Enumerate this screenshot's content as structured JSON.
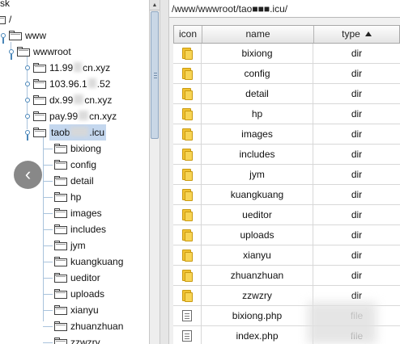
{
  "tree": {
    "top_cut_label": "sk",
    "root_label": "/",
    "www_label": "www",
    "wwwroot_label": "wwwroot",
    "sites": [
      {
        "label_a": "11.99",
        "label_b": "cn.xyz"
      },
      {
        "label_a": "103.96.1",
        "label_b": ".52"
      },
      {
        "label_a": "dx.99",
        "label_b": "cn.xyz"
      },
      {
        "label_a": "pay.99",
        "label_b": "cn.xyz"
      },
      {
        "label_a": "taob",
        "label_b": ".icu"
      }
    ],
    "children": [
      "bixiong",
      "config",
      "detail",
      "hp",
      "images",
      "includes",
      "jym",
      "kuangkuang",
      "ueditor",
      "uploads",
      "xianyu",
      "zhuanzhuan",
      "zzwzry"
    ]
  },
  "nav": {
    "back_glyph": "‹"
  },
  "path_bar": {
    "value": "/www/wwwroot/tao■■■.icu/"
  },
  "table": {
    "headers": {
      "icon": "icon",
      "name": "name",
      "type": "type"
    },
    "rows": [
      {
        "name": "bixiong",
        "type": "dir",
        "icon": "folder-icon"
      },
      {
        "name": "config",
        "type": "dir",
        "icon": "folder-icon"
      },
      {
        "name": "detail",
        "type": "dir",
        "icon": "folder-icon"
      },
      {
        "name": "hp",
        "type": "dir",
        "icon": "folder-icon"
      },
      {
        "name": "images",
        "type": "dir",
        "icon": "folder-icon"
      },
      {
        "name": "includes",
        "type": "dir",
        "icon": "folder-icon"
      },
      {
        "name": "jym",
        "type": "dir",
        "icon": "folder-icon"
      },
      {
        "name": "kuangkuang",
        "type": "dir",
        "icon": "folder-icon"
      },
      {
        "name": "ueditor",
        "type": "dir",
        "icon": "folder-icon"
      },
      {
        "name": "uploads",
        "type": "dir",
        "icon": "folder-icon"
      },
      {
        "name": "xianyu",
        "type": "dir",
        "icon": "folder-icon"
      },
      {
        "name": "zhuanzhuan",
        "type": "dir",
        "icon": "folder-icon"
      },
      {
        "name": "zzwzry",
        "type": "dir",
        "icon": "folder-icon"
      },
      {
        "name": "bixiong.php",
        "type": "file",
        "icon": "file-icon"
      },
      {
        "name": "index.php",
        "type": "file",
        "icon": "file-icon"
      }
    ]
  },
  "colors": {
    "selection": "#c4d7ee",
    "tree_handle": "#4a86b8",
    "folder_yellow": "#f1c232"
  }
}
